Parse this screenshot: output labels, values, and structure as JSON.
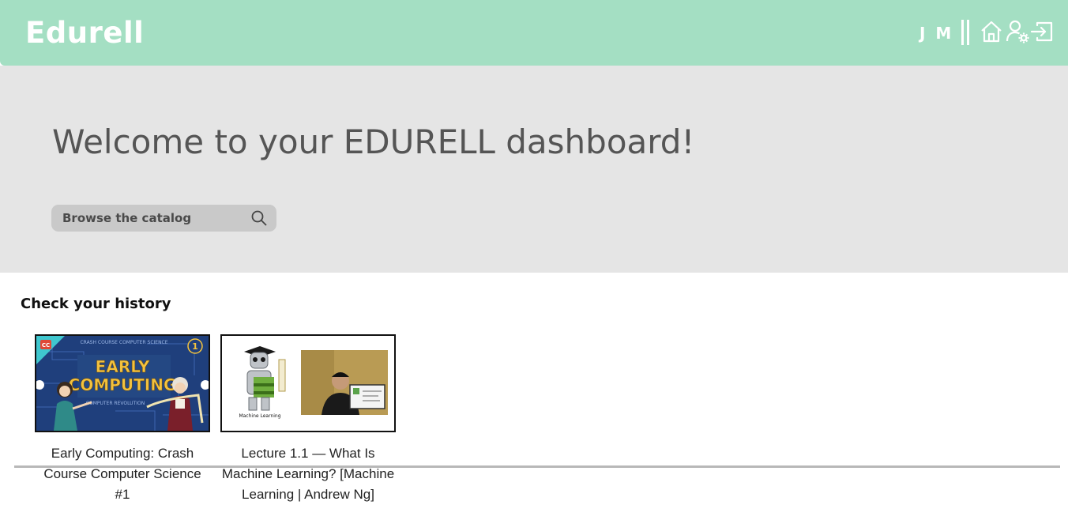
{
  "header": {
    "brand": "Edurell",
    "user_initials": "J M",
    "colors": {
      "bar": "#a4dfc3",
      "text": "#ffffff"
    },
    "icons": [
      "home-icon",
      "user-settings-icon",
      "logout-icon"
    ]
  },
  "hero": {
    "title": "Welcome to your EDURELL dashboard!",
    "search_placeholder": "Browse the catalog",
    "search_icon": "search-icon",
    "background": "#e5e5e5"
  },
  "history": {
    "heading": "Check your history",
    "videos": [
      {
        "title": "Early Computing: Crash Course Computer Science #1",
        "thumbnail": {
          "badge": "CC",
          "episode": "1",
          "banner": "CRASH COURSE COMPUTER SCIENCE",
          "line1": "EARLY",
          "line2": "COMPUTING",
          "subtitle": "COMPUTER REVOLUTION"
        }
      },
      {
        "title": "Lecture 1.1 — What Is Machine Learning? [Machine Learning | Andrew Ng]",
        "thumbnail": {
          "caption": "Machine Learning"
        }
      }
    ]
  }
}
